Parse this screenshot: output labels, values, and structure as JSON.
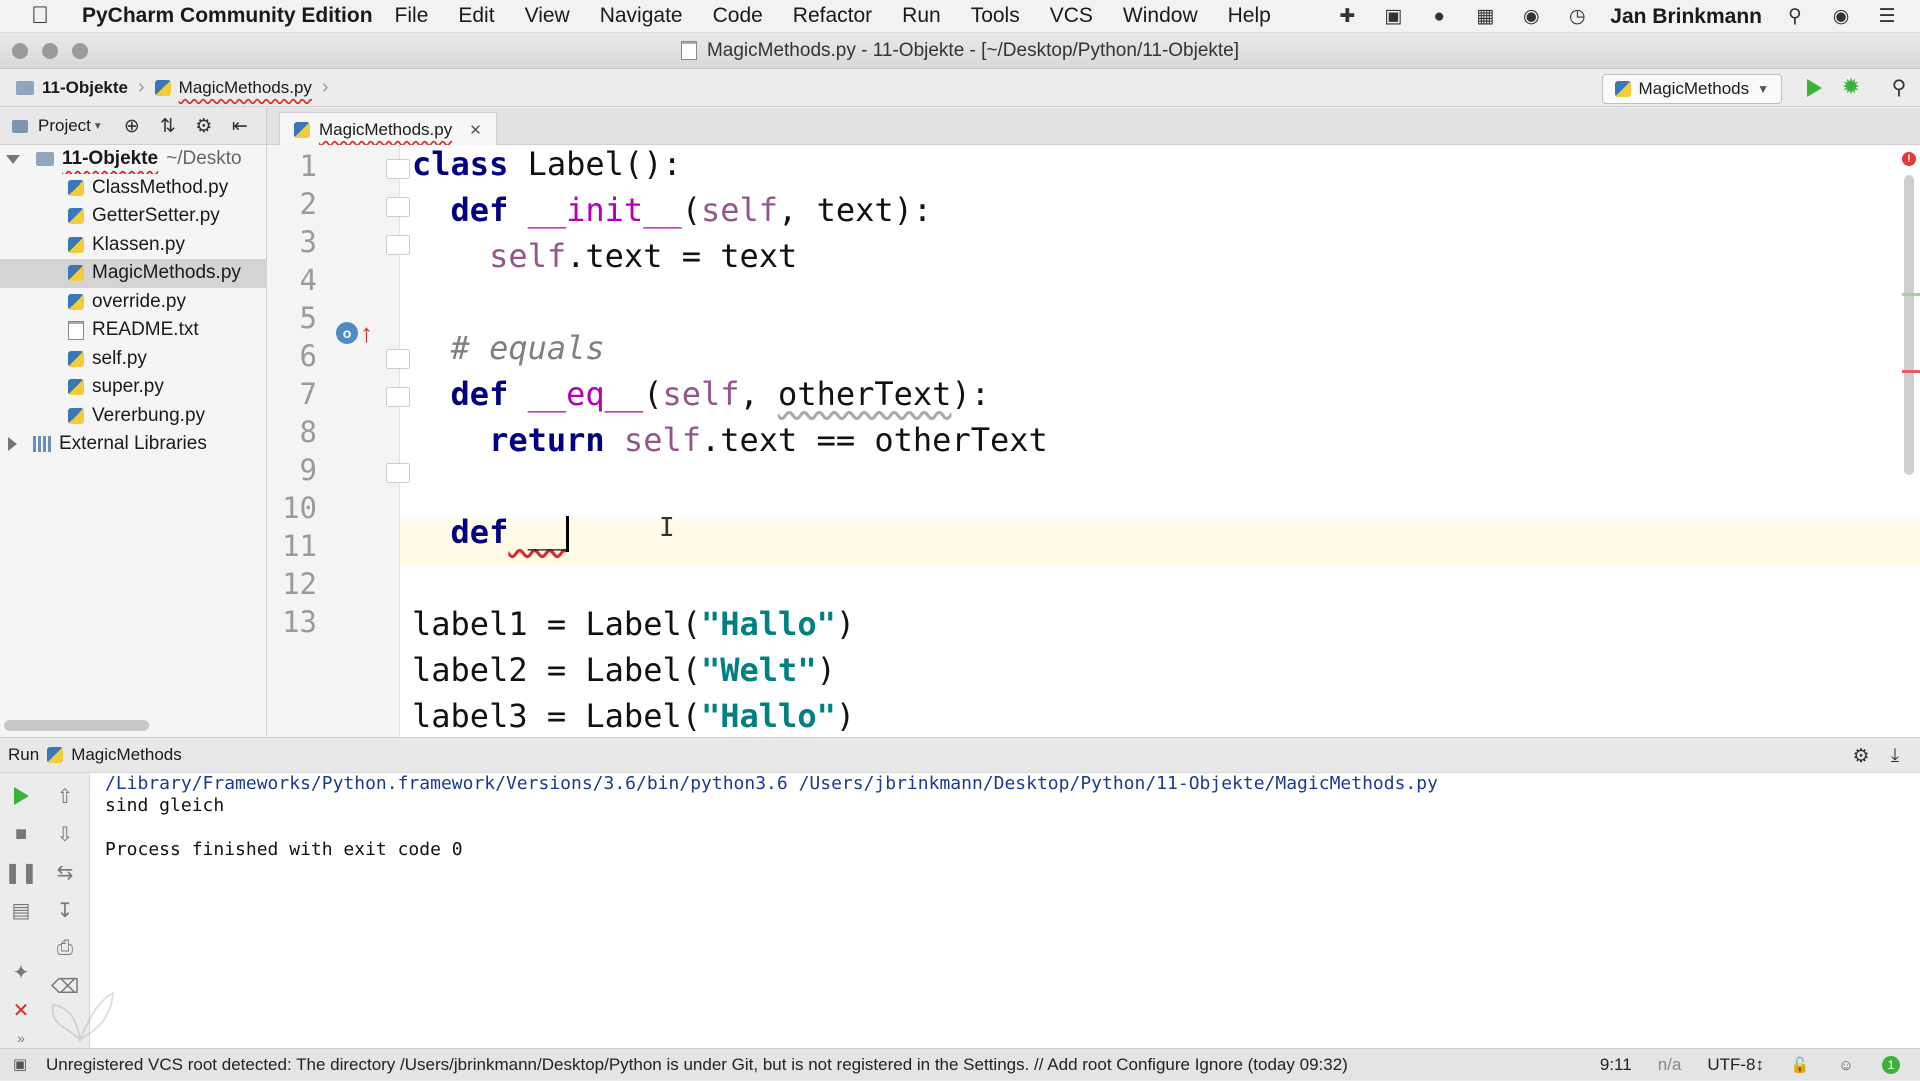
{
  "menubar": {
    "app_name": "PyCharm Community Edition",
    "items": [
      "File",
      "Edit",
      "View",
      "Navigate",
      "Code",
      "Refactor",
      "Run",
      "Tools",
      "VCS",
      "Window",
      "Help"
    ],
    "user": "Jan Brinkmann"
  },
  "window": {
    "title": "MagicMethods.py - 11-Objekte - [~/Desktop/Python/11-Objekte]"
  },
  "navbar": {
    "breadcrumb": [
      "11-Objekte",
      "MagicMethods.py"
    ],
    "run_config": "MagicMethods"
  },
  "project": {
    "header": "Project",
    "root": {
      "name": "11-Objekte",
      "path": "~/Deskto"
    },
    "files": [
      "ClassMethod.py",
      "GetterSetter.py",
      "Klassen.py",
      "MagicMethods.py",
      "override.py",
      "README.txt",
      "self.py",
      "super.py",
      "Vererbung.py"
    ],
    "selected": "MagicMethods.py",
    "external": "External Libraries"
  },
  "editor": {
    "tab": "MagicMethods.py",
    "line_numbers": [
      "1",
      "2",
      "3",
      "4",
      "5",
      "6",
      "7",
      "8",
      "9",
      "10",
      "11",
      "12",
      "13"
    ],
    "lines": {
      "l1_kw": "class",
      "l1_rest": " Label():",
      "l2_kw": "def",
      "l2_name": "__init__",
      "l2_open": "(",
      "l2_self": "self",
      "l2_rest": ", text):",
      "l3_self": "self",
      "l3_rest": ".text = text",
      "l5_comment": "# equals",
      "l6_kw": "def",
      "l6_name": "__eq__",
      "l6_open": "(",
      "l6_self": "self",
      "l6_sep": ", ",
      "l6_param": "otherText",
      "l6_rest": "):",
      "l7_kw": "return",
      "l7_sp": " ",
      "l7_self": "self",
      "l7_rest": ".text == otherText",
      "l9_kw": "def",
      "l9_rest": " __",
      "l11_a": "label1 = Label(",
      "l11_str": "\"Hallo\"",
      "l11_b": ")",
      "l12_a": "label2 = Label(",
      "l12_str": "\"Welt\"",
      "l12_b": ")",
      "l13_a": "label3 = Label(",
      "l13_str": "\"Hallo\"",
      "l13_b": ")"
    }
  },
  "run": {
    "label": "Run",
    "config": "MagicMethods",
    "output": [
      "/Library/Frameworks/Python.framework/Versions/3.6/bin/python3.6 /Users/jbrinkmann/Desktop/Python/11-Objekte/MagicMethods.py",
      "sind gleich",
      "",
      "Process finished with exit code 0"
    ]
  },
  "statusbar": {
    "message": "Unregistered VCS root detected: The directory /Users/jbrinkmann/Desktop/Python is under Git, but is not registered in the Settings. // Add root  Configure  Ignore (today 09:32)",
    "position": "9:11",
    "na": "n/a",
    "encoding": "UTF-8↕"
  },
  "colors": {
    "keyword": "#000080",
    "self": "#94558d",
    "dunder": "#b200b2",
    "string": "#008080",
    "comment": "#808080",
    "current_line": "#fffbe6",
    "run_green": "#3bb33b"
  }
}
